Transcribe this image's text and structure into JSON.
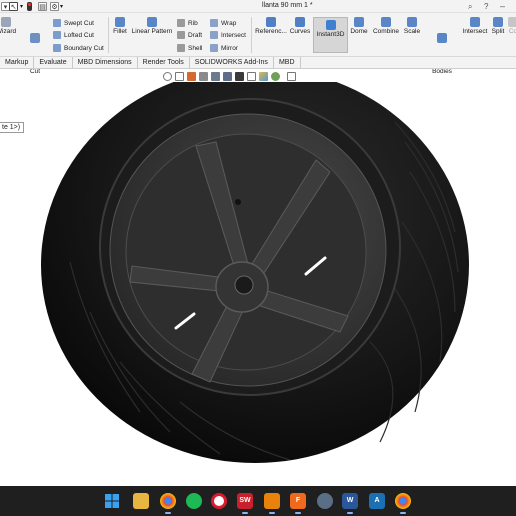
{
  "window": {
    "title": "llanta 90 mm 1 *"
  },
  "ribbon": {
    "wizard": "Wizard",
    "revolved_cut": "Revolved\nCut",
    "swept_cut": "Swept Cut",
    "lofted_cut": "Lofted Cut",
    "boundary_cut": "Boundary Cut",
    "fillet": "Fillet",
    "linear_pattern": "Linear Pattern",
    "rib": "Rib",
    "draft": "Draft",
    "shell": "Shell",
    "wrap": "Wrap",
    "intersect_small": "Intersect",
    "mirror": "Mirror",
    "reference": "Referenc...",
    "curves": "Curves",
    "instant3d": "Instant3D",
    "dome": "Dome",
    "combine": "Combine",
    "scale": "Scale",
    "move_copy_bodies": "Move/Copy\nBodies",
    "intersect": "Intersect",
    "split": "Split",
    "cut_off": "Co"
  },
  "tabs": [
    "Markup",
    "Evaluate",
    "MBD Dimensions",
    "Render Tools",
    "SOLIDWORKS Add-Ins",
    "MBD"
  ],
  "canvas": {
    "config_tag": "te 1>)"
  },
  "taskbar": {
    "items": [
      {
        "name": "start-icon",
        "label": ""
      },
      {
        "name": "file-explorer-icon",
        "label": ""
      },
      {
        "name": "chrome-icon",
        "label": ""
      },
      {
        "name": "spotify-icon",
        "label": ""
      },
      {
        "name": "opera-icon",
        "label": ""
      },
      {
        "name": "solidworks-icon",
        "label": "SW"
      },
      {
        "name": "app-orange-icon",
        "label": ""
      },
      {
        "name": "fusion-icon",
        "label": "F"
      },
      {
        "name": "settings-icon",
        "label": ""
      },
      {
        "name": "word-icon",
        "label": "W"
      },
      {
        "name": "autodesk-icon",
        "label": "A"
      },
      {
        "name": "chrome-profile-icon",
        "label": ""
      }
    ]
  },
  "colors": {
    "accent_blue": "#2f7fd0",
    "tire": "#141414",
    "rim": "#3d3d3d",
    "taskbar": "#1f1f1f"
  }
}
